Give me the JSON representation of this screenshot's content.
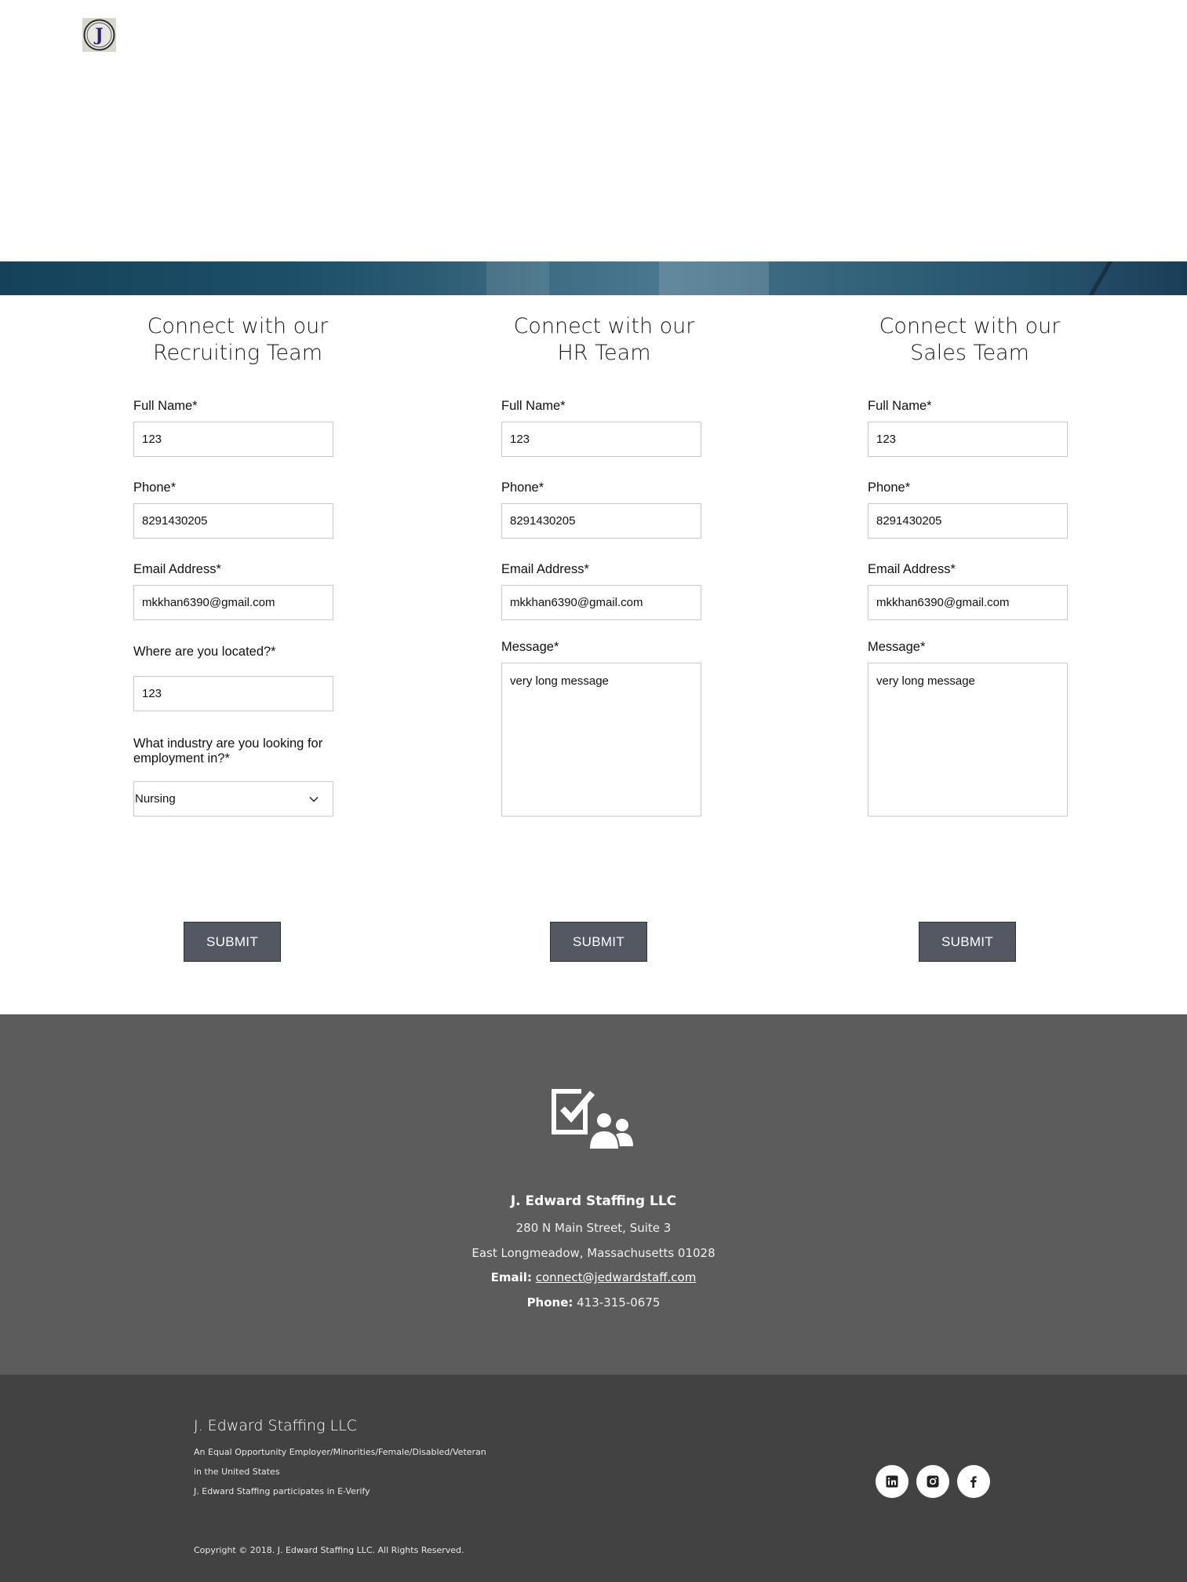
{
  "header": {
    "logo_name": "j-edward-logo",
    "logo_text": "J"
  },
  "forms": [
    {
      "title_line1": "Connect with our",
      "title_line2": "Recruiting Team",
      "full_name_label": "Full Name*",
      "full_name_value": "123",
      "phone_label": "Phone*",
      "phone_value": "8291430205",
      "email_label": "Email Address*",
      "email_value": "mkkhan6390@gmail.com",
      "location_label": "Where are you located?*",
      "location_value": "123",
      "industry_label_line1": "What industry are you looking for",
      "industry_label_line2": "employment in?*",
      "industry_value": "Nursing",
      "submit_label": "SUBMIT"
    },
    {
      "title_line1": "Connect with our",
      "title_line2": "HR Team",
      "full_name_label": "Full Name*",
      "full_name_value": "123",
      "phone_label": "Phone*",
      "phone_value": "8291430205",
      "email_label": "Email Address*",
      "email_value": "mkkhan6390@gmail.com",
      "message_label": "Message*",
      "message_value": "very long message",
      "submit_label": "SUBMIT"
    },
    {
      "title_line1": "Connect with our",
      "title_line2": "Sales Team",
      "full_name_label": "Full Name*",
      "full_name_value": "123",
      "phone_label": "Phone*",
      "phone_value": "8291430205",
      "email_label": "Email Address*",
      "email_value": "mkkhan6390@gmail.com",
      "message_label": "Message*",
      "message_value": "very long message",
      "submit_label": "SUBMIT"
    }
  ],
  "contact": {
    "icon_name": "checklist-people-icon",
    "company": "J. Edward Staffing LLC",
    "address1": "280 N Main Street, Suite 3",
    "address2": "East Longmeadow, Massachusetts 01028",
    "email_label": "Email:",
    "email_value": "connect@jedwardstaff.com",
    "phone_label": "Phone:",
    "phone_value": "413-315-0675"
  },
  "footer": {
    "company": "J. Edward Staffing LLC",
    "eeo_line1": "An Equal Opportunity Employer/Minorities/Female/Disabled/Veteran",
    "eeo_line2": "in the United States",
    "everify": "J. Edward Staffing participates in E-Verify",
    "copyright": "Copyright © 2018. J. Edward Staffing LLC. All Rights Reserved.",
    "social": [
      "linkedin-icon",
      "instagram-icon",
      "facebook-icon"
    ]
  },
  "colors": {
    "button_bg": "#535862",
    "contact_bg": "#5c5c5c",
    "footer_bg": "#424242",
    "banner": "#1d4f69"
  }
}
